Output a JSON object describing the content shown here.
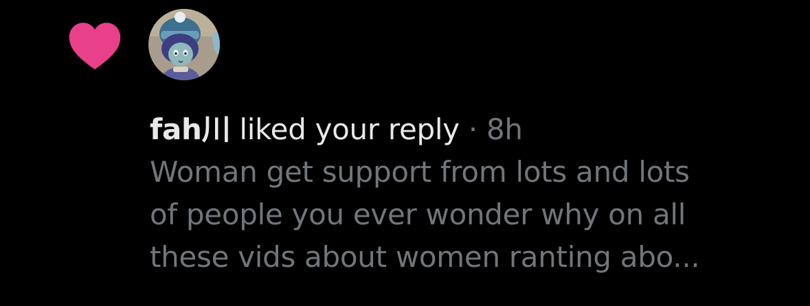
{
  "notification": {
    "icon": "heart-icon",
    "icon_color": "#f91880",
    "avatar": "avatar",
    "username": "fah川",
    "action": "liked your reply",
    "separator": "·",
    "time": "8h",
    "reply_lines": [
      "Woman get support from lots and lots",
      "of people you ever wonder why on all",
      "these vids about women ranting abo..."
    ]
  }
}
